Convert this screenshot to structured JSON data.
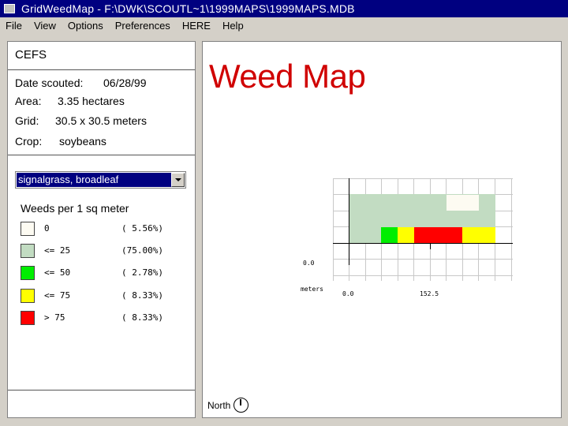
{
  "window": {
    "title": "GridWeedMap - F:\\DWK\\SCOUTL~1\\1999MAPS\\1999MAPS.MDB"
  },
  "menu": [
    "File",
    "View",
    "Options",
    "Preferences",
    "HERE",
    "Help"
  ],
  "field": {
    "name": "CEFS",
    "date_label": "Date scouted:",
    "date_value": "06/28/99",
    "area_label": "Area:",
    "area_value": "3.35 hectares",
    "grid_label": "Grid:",
    "grid_value": "30.5 x 30.5 meters",
    "crop_label": "Crop:",
    "crop_value": "soybeans"
  },
  "weed_select": {
    "selected": "signalgrass, broadleaf"
  },
  "legend": {
    "title": "Weeds per 1 sq meter",
    "items": [
      {
        "range": "0",
        "percent": "( 5.56%)",
        "color": "#fdfbf2"
      },
      {
        "range": "<= 25",
        "percent": "(75.00%)",
        "color": "#c2dcc2"
      },
      {
        "range": "<= 50",
        "percent": "( 2.78%)",
        "color": "#00ee00"
      },
      {
        "range": "<= 75",
        "percent": "( 8.33%)",
        "color": "#ffff00"
      },
      {
        "range": "> 75",
        "percent": "( 8.33%)",
        "color": "#ff0000"
      }
    ]
  },
  "map": {
    "title": "Weed Map",
    "y_label": "0.0",
    "units_label": "meters",
    "x_tick_0": "0.0",
    "x_tick_1": "152.5",
    "north_label": "North"
  }
}
